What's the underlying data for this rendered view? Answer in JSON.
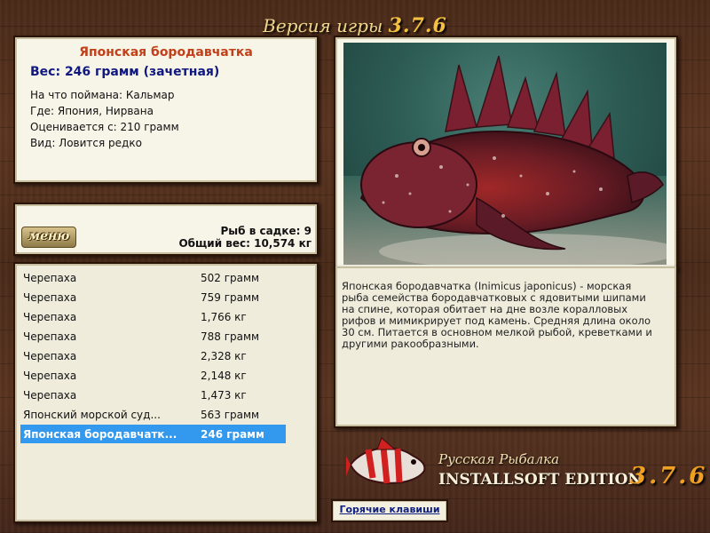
{
  "header": {
    "title_text": "Версия игры",
    "title_version": "3.7.6"
  },
  "fish_info": {
    "name": "Японская бородавчатка",
    "weight": "Вес: 246 грамм (зачетная)",
    "bait": "На что поймана: Кальмар",
    "location": "Где: Япония, Нирвана",
    "rated_from": "Оценивается с: 210 грамм",
    "rarity": "Вид: Ловится редко"
  },
  "stats": {
    "menu_label": "меню",
    "fish_in_keepnet": "Рыб в садке: 9",
    "total_weight": "Общий вес: 10,574 кг"
  },
  "catch_list": [
    {
      "name": "Черепаха",
      "weight": "502 грамм"
    },
    {
      "name": "Черепаха",
      "weight": "759 грамм"
    },
    {
      "name": "Черепаха",
      "weight": "1,766 кг"
    },
    {
      "name": "Черепаха",
      "weight": "788 грамм"
    },
    {
      "name": "Черепаха",
      "weight": "2,328 кг"
    },
    {
      "name": "Черепаха",
      "weight": "2,148 кг"
    },
    {
      "name": "Черепаха",
      "weight": "1,473 кг"
    },
    {
      "name": "Японский морской суд...",
      "weight": "563 грамм"
    },
    {
      "name": "Японская бородавчатк...",
      "weight": "246 грамм",
      "selected": true
    }
  ],
  "description": "Японская бородавчатка (Inimicus japonicus) - морская рыба семейства бородавчатковых с ядовитыми шипами на спине, которая обитает на дне возле коралловых рифов и мимикрирует под камень. Средняя длина около 30 см. Питается в основном мелкой рыбой, креветками и другими ракообразными.",
  "brand": {
    "line1": "Русская Рыбалка",
    "line2": "INSTALLSOFT EDITION",
    "version": "3.7.6"
  },
  "hotkeys_label": "Горячие клавиши",
  "colors": {
    "selected_row": "#3399ee",
    "fish_name": "#c0401a",
    "weight_text": "#101880"
  }
}
